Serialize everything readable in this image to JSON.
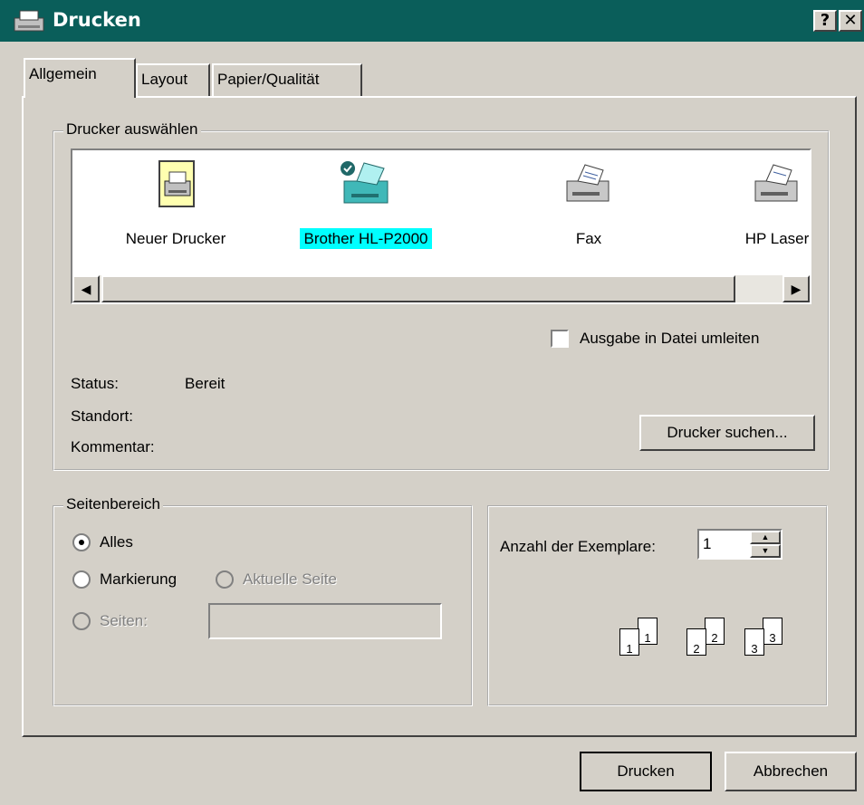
{
  "window": {
    "title": "Drucken",
    "help_glyph": "?",
    "close_glyph": "✕"
  },
  "tabs": [
    {
      "label": "Allgemein",
      "active": true
    },
    {
      "label": "Layout",
      "active": false
    },
    {
      "label": "Papier/Qualität",
      "active": false
    }
  ],
  "printer_group": {
    "label": "Drucker auswählen",
    "printers": [
      {
        "name": "Neuer Drucker",
        "icon": "add-printer-icon",
        "selected": false
      },
      {
        "name": "Brother HL-P2000",
        "icon": "default-printer-icon",
        "selected": true
      },
      {
        "name": "Fax",
        "icon": "fax-printer-icon",
        "selected": false
      },
      {
        "name": "HP Laser",
        "icon": "printer-icon",
        "selected": false
      }
    ],
    "scroll_left_glyph": "◀",
    "scroll_right_glyph": "▶",
    "redirect_label": "Ausgabe in Datei umleiten",
    "redirect_checked": false,
    "status_label": "Status:",
    "status_value": "Bereit",
    "location_label": "Standort:",
    "comment_label": "Kommentar:",
    "find_button": "Drucker suchen..."
  },
  "range_group": {
    "label": "Seitenbereich",
    "all_label": "Alles",
    "selection_label": "Markierung",
    "current_label": "Aktuelle Seite",
    "pages_label": "Seiten:",
    "selected": "all"
  },
  "copies_group": {
    "copies_label": "Anzahl der Exemplare:",
    "copies_value": "1",
    "collate_pages": [
      "1",
      "1",
      "2",
      "2",
      "3",
      "3"
    ]
  },
  "footer": {
    "print_button": "Drucken",
    "cancel_button": "Abbrechen"
  },
  "colors": {
    "titlebar": "#0a5e5a",
    "face": "#d4d0c8",
    "selection": "#00ffff"
  }
}
